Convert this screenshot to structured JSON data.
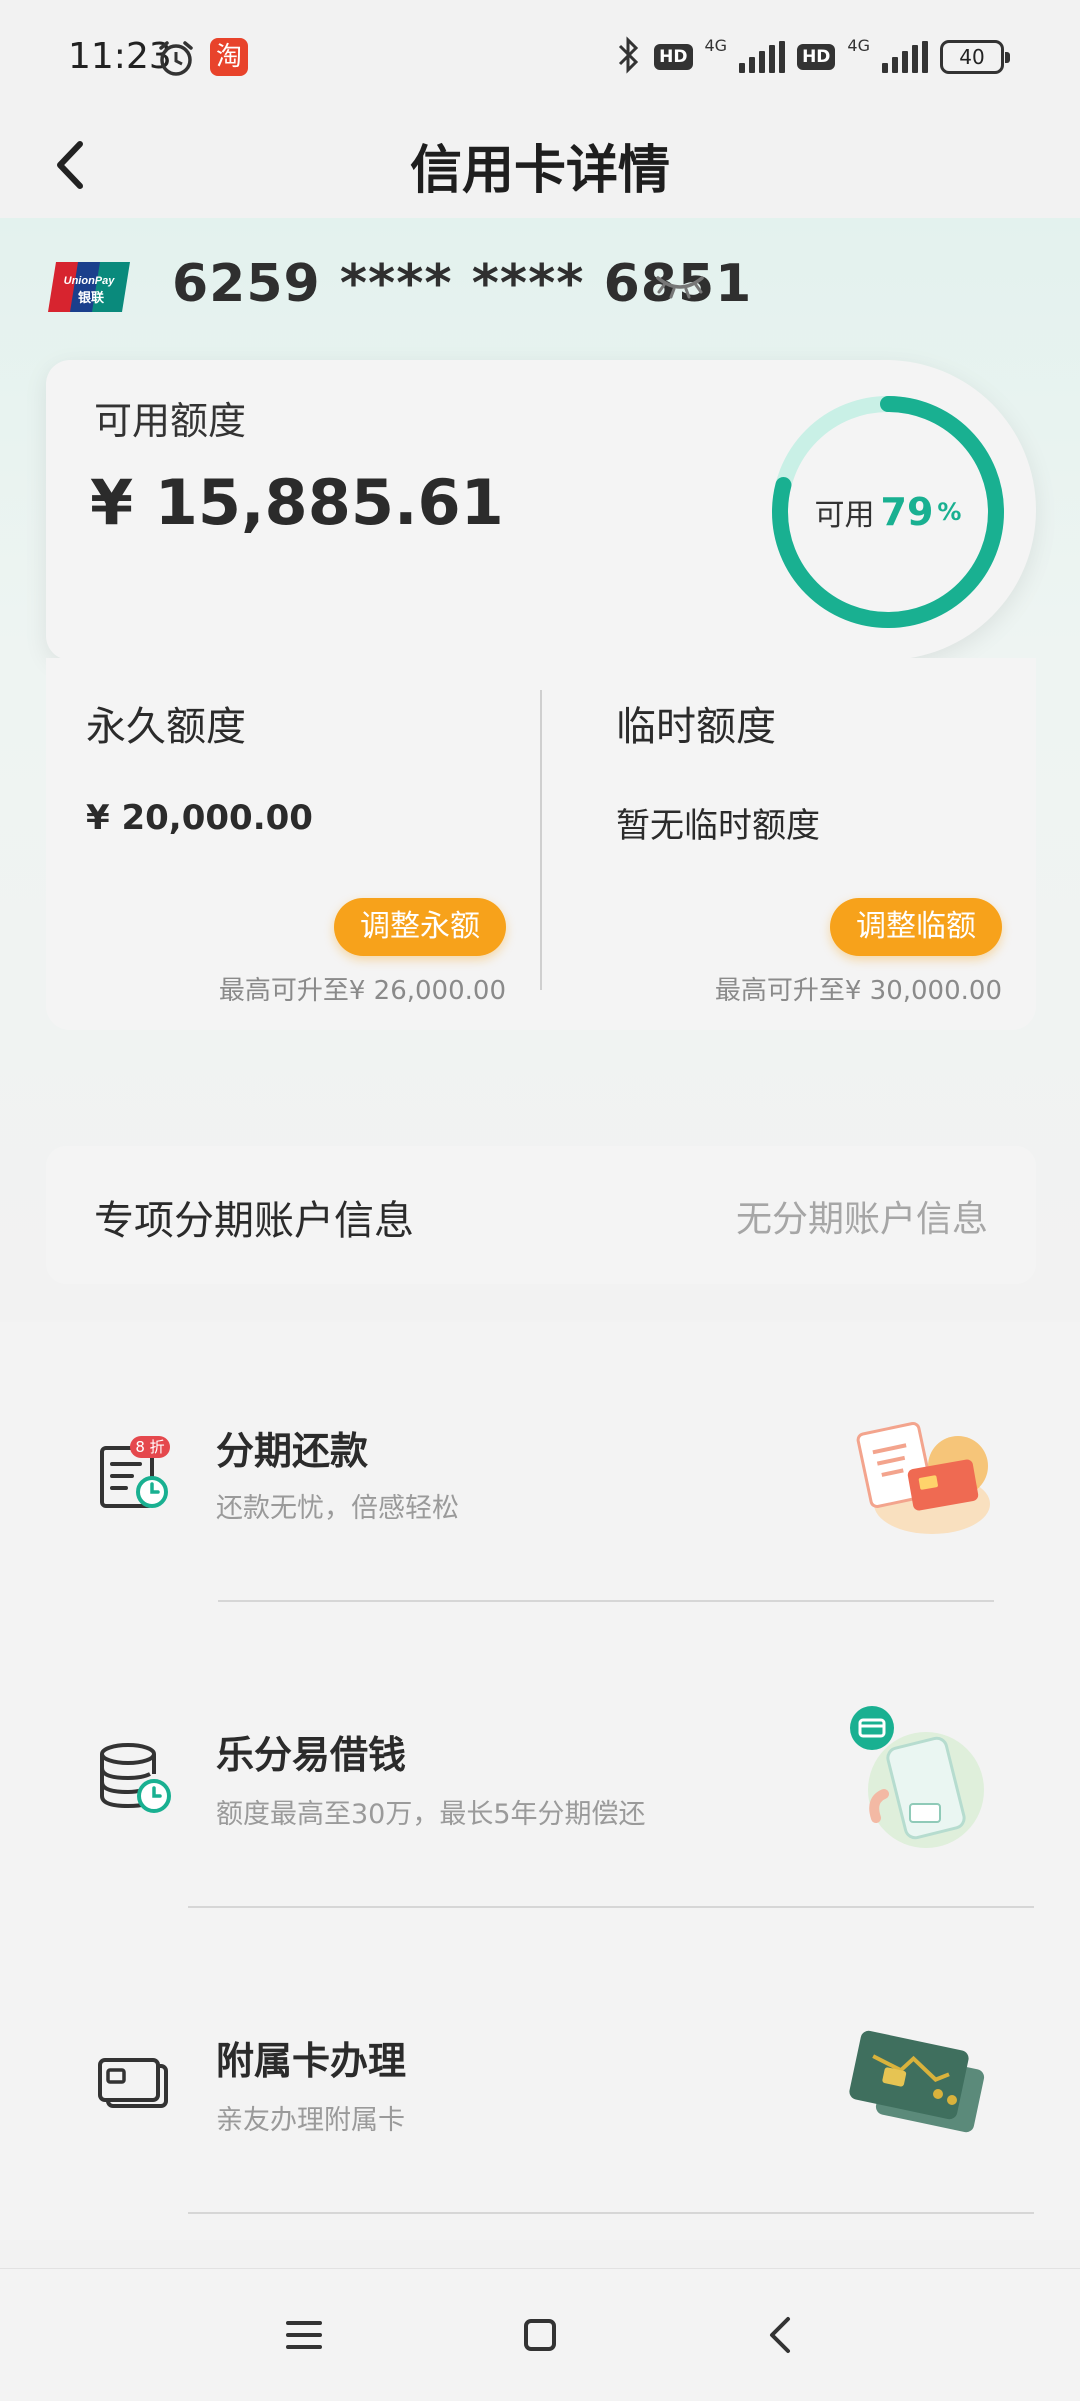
{
  "status_bar": {
    "time": "11:23",
    "taobao_glyph": "淘",
    "hd": "HD",
    "net": "4G",
    "battery": "40"
  },
  "header": {
    "title": "信用卡详情"
  },
  "card": {
    "number": "6259 **** **** 6851",
    "logo_text_top": "UnionPay",
    "logo_text_bottom": "银联"
  },
  "available": {
    "label": "可用额度",
    "amount": "¥ 15,885.61",
    "ring_label": "可用",
    "ring_percent": "79",
    "ring_unit": "%",
    "ring_fraction": 0.79,
    "accent_color": "#19b091"
  },
  "limits": {
    "permanent": {
      "title": "永久额度",
      "value": "¥ 20,000.00",
      "button": "调整永额",
      "max": "最高可升至¥ 26,000.00"
    },
    "temporary": {
      "title": "临时额度",
      "value": "暂无临时额度",
      "button": "调整临额",
      "max": "最高可升至¥ 30,000.00"
    },
    "button_color": "#f7a21b"
  },
  "special": {
    "title": "专项分期账户信息",
    "value": "无分期账户信息"
  },
  "services": [
    {
      "title": "分期还款",
      "subtitle": "还款无忧，倍感轻松",
      "badge": "8 折",
      "icon": "installment-bill-icon"
    },
    {
      "title": "乐分易借钱",
      "subtitle": "额度最高至30万，最长5年分期偿还",
      "icon": "coin-stack-clock-icon"
    },
    {
      "title": "附属卡办理",
      "subtitle": "亲友办理附属卡",
      "icon": "cards-icon"
    }
  ]
}
